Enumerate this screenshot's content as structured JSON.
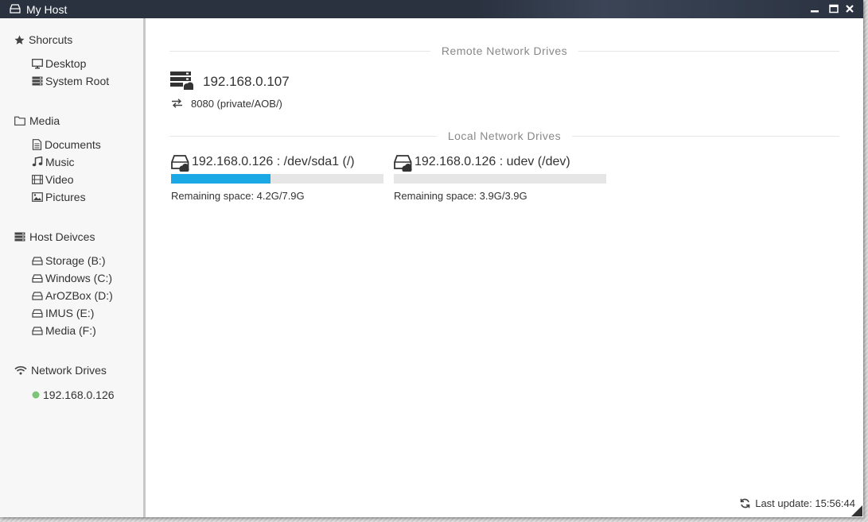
{
  "window": {
    "title": "My Host"
  },
  "sidebar": {
    "shortcuts": {
      "label": "Shorcuts",
      "items": [
        {
          "label": "Desktop",
          "icon": "monitor-icon"
        },
        {
          "label": "System Root",
          "icon": "server-icon"
        }
      ]
    },
    "media": {
      "label": "Media",
      "items": [
        {
          "label": "Documents",
          "icon": "document-icon"
        },
        {
          "label": "Music",
          "icon": "music-icon"
        },
        {
          "label": "Video",
          "icon": "film-icon"
        },
        {
          "label": "Pictures",
          "icon": "picture-icon"
        }
      ]
    },
    "host_devices": {
      "label": "Host Deivces",
      "items": [
        {
          "label": "Storage (B:)",
          "icon": "drive-icon"
        },
        {
          "label": "Windows (C:)",
          "icon": "drive-icon"
        },
        {
          "label": "ArOZBox (D:)",
          "icon": "drive-icon"
        },
        {
          "label": "IMUS (E:)",
          "icon": "drive-icon"
        },
        {
          "label": "Media (F:)",
          "icon": "drive-icon"
        }
      ]
    },
    "network_drives": {
      "label": "Network Drives",
      "items": [
        {
          "label": "192.168.0.126",
          "status_color": "#7cc576"
        }
      ]
    }
  },
  "main": {
    "remote_header": "Remote Network Drives",
    "remote": {
      "ip": "192.168.0.107",
      "port": "8080 (private/AOB/)"
    },
    "local_header": "Local Network Drives",
    "local_drives": [
      {
        "title": "192.168.0.126 : /dev/sda1 (/)",
        "space": "Remaining space: 4.2G/7.9G",
        "used_fraction": 0.468
      },
      {
        "title": "192.168.0.126 : udev (/dev)",
        "space": "Remaining space: 3.9G/3.9G",
        "used_fraction": 0.0
      }
    ],
    "last_update": "Last update: 15:56:44"
  },
  "colors": {
    "accent": "#1ba9e6",
    "titlebar": "#2a3240",
    "online": "#7cc576"
  }
}
